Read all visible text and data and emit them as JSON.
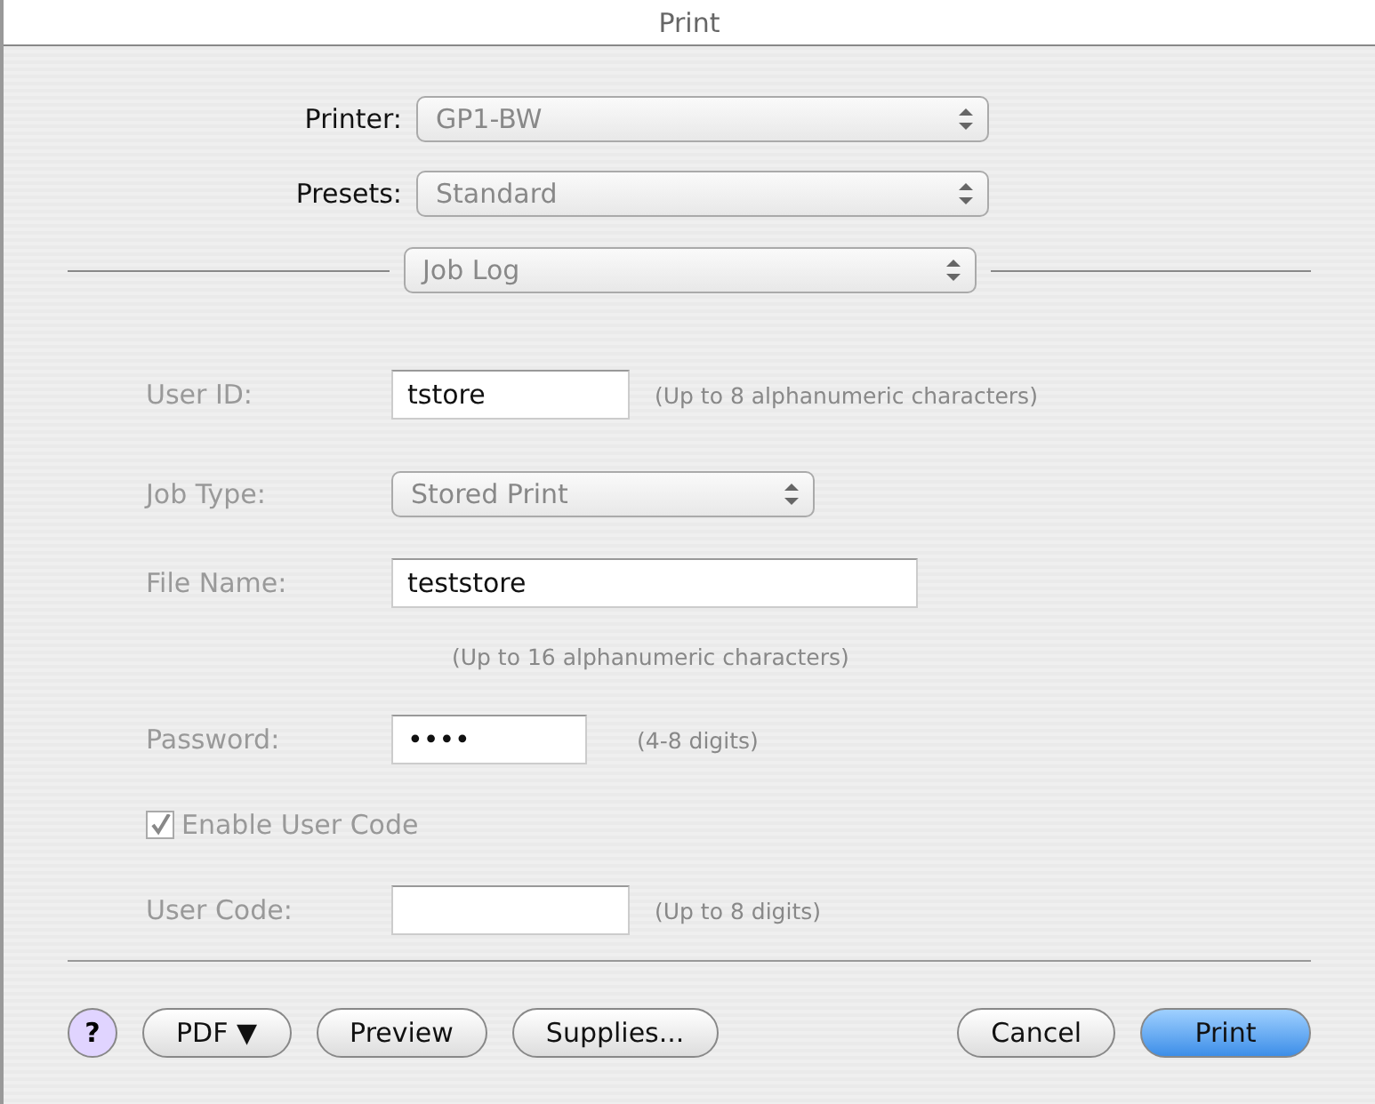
{
  "window": {
    "title": "Print"
  },
  "selectors": [
    {
      "label": "Printer:",
      "value": "GP1-BW"
    },
    {
      "label": "Presets:",
      "value": "Standard"
    }
  ],
  "panel_menu": {
    "value": "Job Log"
  },
  "form": [
    {
      "kind": "text",
      "label": "User ID:",
      "value": "tstore",
      "hint": "(Up to 8 alphanumeric characters)"
    },
    {
      "kind": "popup",
      "label": "Job Type:",
      "value": "Stored Print"
    },
    {
      "kind": "text",
      "label": "File Name:",
      "value": "teststore",
      "hint_below": "(Up to 16 alphanumeric characters)"
    },
    {
      "kind": "password",
      "label": "Password:",
      "value": "••••",
      "hint": "(4-8 digits)"
    },
    {
      "kind": "checkbox",
      "label": "Enable User Code",
      "checked": true
    },
    {
      "kind": "text",
      "label": "User Code:",
      "hint": "(Up to 8 digits)"
    }
  ],
  "help": {
    "label": "?"
  },
  "left_buttons": [
    {
      "label": "PDF ▼"
    },
    {
      "label": "Preview"
    },
    {
      "label": "Supplies..."
    }
  ],
  "right_buttons": [
    {
      "label": "Cancel",
      "default": false
    },
    {
      "label": "Print",
      "default": true
    }
  ]
}
